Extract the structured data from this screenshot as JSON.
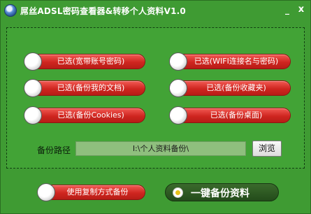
{
  "window": {
    "title": "屌丝ADSL密码查看器&转移个人资料V1.0"
  },
  "controls": {
    "minimize": "_",
    "close": "x"
  },
  "options": [
    {
      "label": "已选(宽带账号密码)"
    },
    {
      "label": "已选(WIFI连接名与密码)"
    },
    {
      "label": "已选(备份我的文档)"
    },
    {
      "label": "已选(备份收藏夹)"
    },
    {
      "label": "已选(备份Cookies)"
    },
    {
      "label": "已选(备份桌面)"
    }
  ],
  "backup_path": {
    "label": "备份路径",
    "value": "I:\\个人资料备份\\"
  },
  "browse_button": "浏览",
  "copy_mode": {
    "label": "使用复制方式备份"
  },
  "one_click_backup": "一键备份资料"
}
